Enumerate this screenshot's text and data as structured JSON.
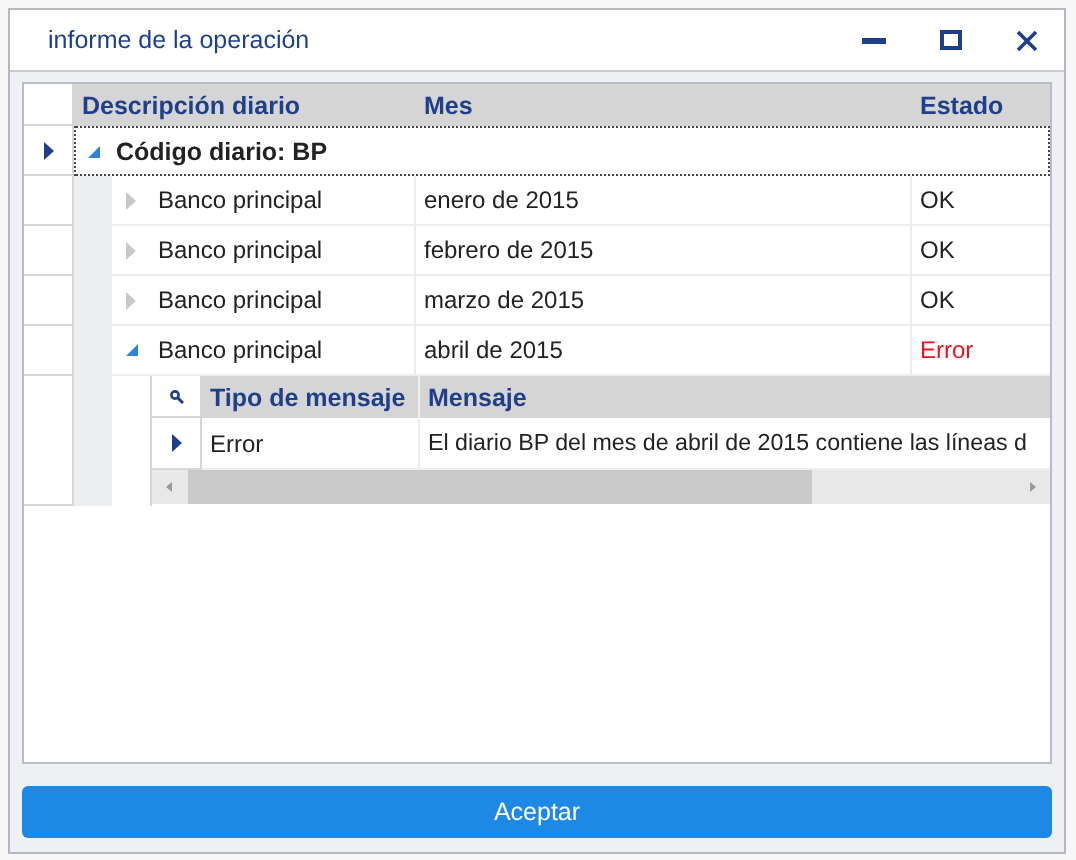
{
  "window": {
    "title": "informe de la operación"
  },
  "grid": {
    "columns": [
      "Descripción diario",
      "Mes",
      "Estado"
    ],
    "group": {
      "label": "Código diario: BP",
      "expanded": true,
      "current": true,
      "rows": [
        {
          "description": "Banco principal",
          "month": "enero de 2015",
          "status": "OK",
          "kind": "ok",
          "expanded": false
        },
        {
          "description": "Banco principal",
          "month": "febrero de 2015",
          "status": "OK",
          "kind": "ok",
          "expanded": false
        },
        {
          "description": "Banco principal",
          "month": "marzo de 2015",
          "status": "OK",
          "kind": "ok",
          "expanded": false
        },
        {
          "description": "Banco principal",
          "month": "abril de 2015",
          "status": "Error",
          "kind": "error",
          "expanded": true,
          "detail": {
            "columns": [
              "Tipo de mensaje",
              "Mensaje"
            ],
            "rows": [
              {
                "type": "Error",
                "message": "El diario BP del mes de abril de 2015 contiene las líneas d",
                "current": true
              }
            ]
          }
        }
      ]
    }
  },
  "buttons": [
    "Aceptar"
  ]
}
